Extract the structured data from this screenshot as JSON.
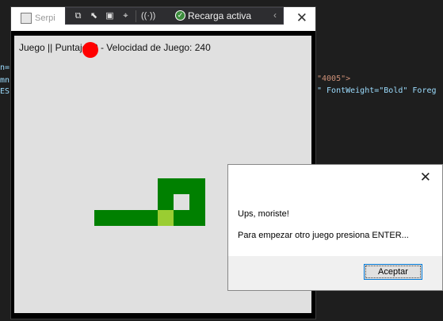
{
  "editor": {
    "lines_left": [
      "n=",
      "mn",
      "ES"
    ],
    "line_right_1": "\"4005\">",
    "line_right_2": "\" FontWeight=\"Bold\" Foreg"
  },
  "window": {
    "title": "Serpi",
    "close_glyph": "✕"
  },
  "toolbar": {
    "recarga_label": "Recarga activa",
    "check_glyph": "✓",
    "chevron_glyph": "‹"
  },
  "game": {
    "status_text": "Juego || Puntaje: 0 - Velocidad de Juego: 240"
  },
  "dialog": {
    "message": "Ups, moriste!",
    "instruction": "Para empezar otro juego presiona ENTER...",
    "ok_label": "Aceptar",
    "close_glyph": "✕"
  },
  "colors": {
    "snake_body": "#008000",
    "snake_head": "#9acd32",
    "board": "#e0e0e0",
    "cursor_marker": "#ff0000"
  }
}
